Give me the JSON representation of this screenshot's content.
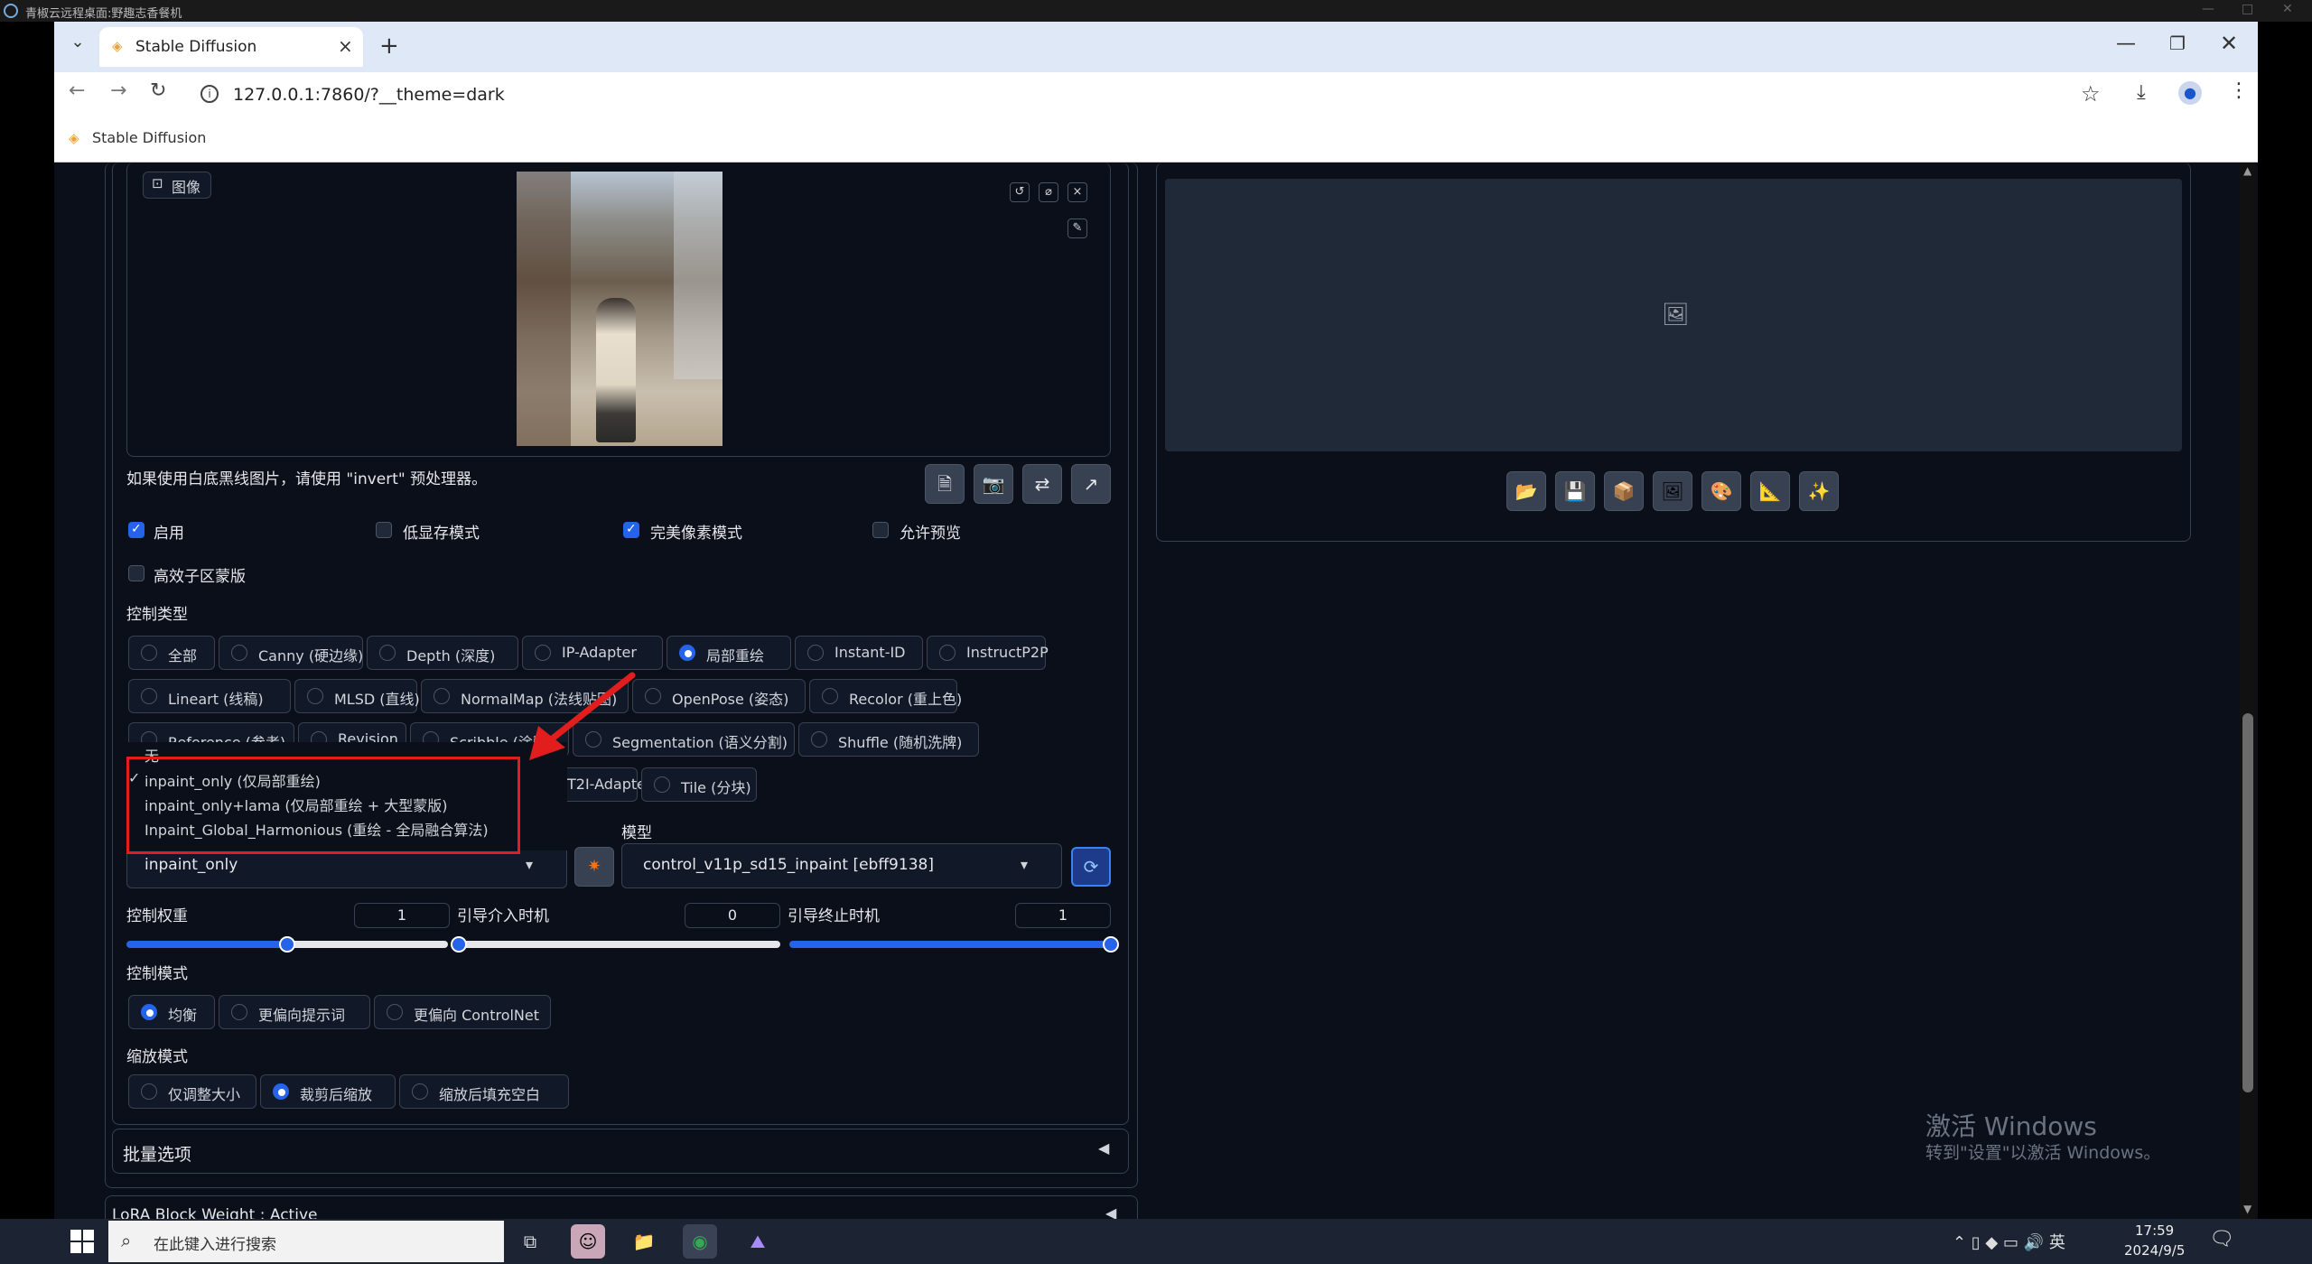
{
  "remote_desktop": {
    "title": "青椒云远程桌面:野趣志香餐机"
  },
  "browser": {
    "tab_title": "Stable Diffusion",
    "url": "127.0.0.1:7860/?__theme=dark",
    "bookmark": "Stable Diffusion"
  },
  "controlnet": {
    "image_label": "图像",
    "invert_hint": "如果使用白底黑线图片，请使用 \"invert\" 预处理器。",
    "checkboxes": [
      {
        "label": "启用",
        "checked": true
      },
      {
        "label": "低显存模式",
        "checked": false
      },
      {
        "label": "完美像素模式",
        "checked": true
      },
      {
        "label": "允许预览",
        "checked": false
      },
      {
        "label": "高效子区蒙版",
        "checked": false
      }
    ],
    "control_type_label": "控制类型",
    "control_types_row1": [
      "全部",
      "Canny (硬边缘)",
      "Depth (深度)",
      "IP-Adapter",
      "局部重绘",
      "Instant-ID",
      "InstructP2P"
    ],
    "control_types_row2": [
      "Lineart (线稿)",
      "MLSD (直线)",
      "NormalMap (法线贴图)",
      "OpenPose (姿态)",
      "Recolor (重上色)"
    ],
    "control_types_row3": [
      "Reference (参考)",
      "Revision",
      "Scribble (涂鸦)",
      "Segmentation (语义分割)",
      "Shuffle (随机洗牌)"
    ],
    "control_types_row4": [
      "T2I-Adapter",
      "Tile (分块)"
    ],
    "selected_control_type": "局部重绘",
    "preprocessor_options": [
      "无",
      "inpaint_only (仅局部重绘)",
      "inpaint_only+lama (仅局部重绘 + 大型蒙版)",
      "Inpaint_Global_Harmonious (重绘 - 全局融合算法)"
    ],
    "preprocessor_value": "inpaint_only",
    "model_label": "模型",
    "model_value": "control_v11p_sd15_inpaint [ebff9138]",
    "sliders": [
      {
        "label": "控制权重",
        "value": "1",
        "fraction": 0.5
      },
      {
        "label": "引导介入时机",
        "value": "0",
        "fraction": 0.0
      },
      {
        "label": "引导终止时机",
        "value": "1",
        "fraction": 1.0
      }
    ],
    "control_mode_label": "控制模式",
    "control_modes": [
      "均衡",
      "更偏向提示词",
      "更偏向 ControlNet"
    ],
    "selected_control_mode": "均衡",
    "resize_mode_label": "缩放模式",
    "resize_modes": [
      "仅调整大小",
      "裁剪后缩放",
      "缩放后填充空白"
    ],
    "selected_resize_mode": "裁剪后缩放",
    "batch_label": "批量选项",
    "lora_label": "LoRA Block Weight : Active"
  },
  "windows_watermark": {
    "line1": "激活 Windows",
    "line2": "转到\"设置\"以激活 Windows。"
  },
  "taskbar": {
    "search_placeholder": "在此键入进行搜索",
    "ime": "英",
    "time": "17:59",
    "date": "2024/9/5"
  },
  "colors": {
    "accent": "#2563eb",
    "annotation_red": "#e11d1d",
    "page_bg": "#0b0f19"
  }
}
